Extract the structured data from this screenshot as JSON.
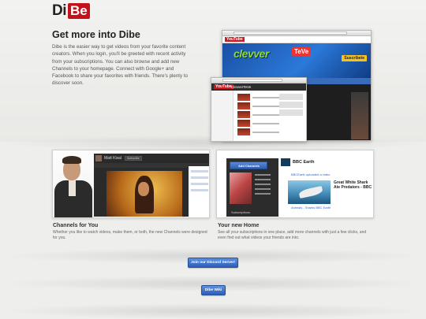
{
  "brand": {
    "logo_part1": "Di",
    "logo_part2": "Be",
    "accent": "#c4121c"
  },
  "hero": {
    "title": "Get more into Dibe",
    "body": "Dibe is the easier way to get videos from your favorite content creators. When you login, you'll be greeted with recent activity from your subscriptions. You can also browse and add new Channels to your homepage. Connect with Google+ and Facebook to share your favorites with friends. There's plenty to discover soon."
  },
  "screens": {
    "big": {
      "site_logo": "YouTube",
      "banner_text": "clevver",
      "badge": "TeVe",
      "subscribe": "Suscríbete"
    },
    "small": {
      "site_logo": "YouTube",
      "channel_title": "ClevverTeVe"
    }
  },
  "features": [
    {
      "title": "Channels for You",
      "desc": "Whether you like to watch videos, make them, or both, the new Channels were designed for you.",
      "mock_channel_name": "Matt Kisal",
      "mock_button": "Subscribe"
    },
    {
      "title": "Your new Home",
      "desc": "See all your subscriptions in one place, add more channels with just a few clicks, and even find out what videos your friends are into.",
      "add_channels_label": "Add Channels",
      "subscriptions_label": "Subscriptions",
      "bbc_channel": "BBC Earth",
      "bbc_item_title": "Great White Shark Ate Predators - BBC",
      "bbc_activity": "BBCEarth uploaded a video",
      "bbc_source": "Animals - Sharks BBC Earth"
    }
  ],
  "buttons": {
    "discord": "Join our Discord Server!",
    "dibe": "Dibe Wiki"
  }
}
